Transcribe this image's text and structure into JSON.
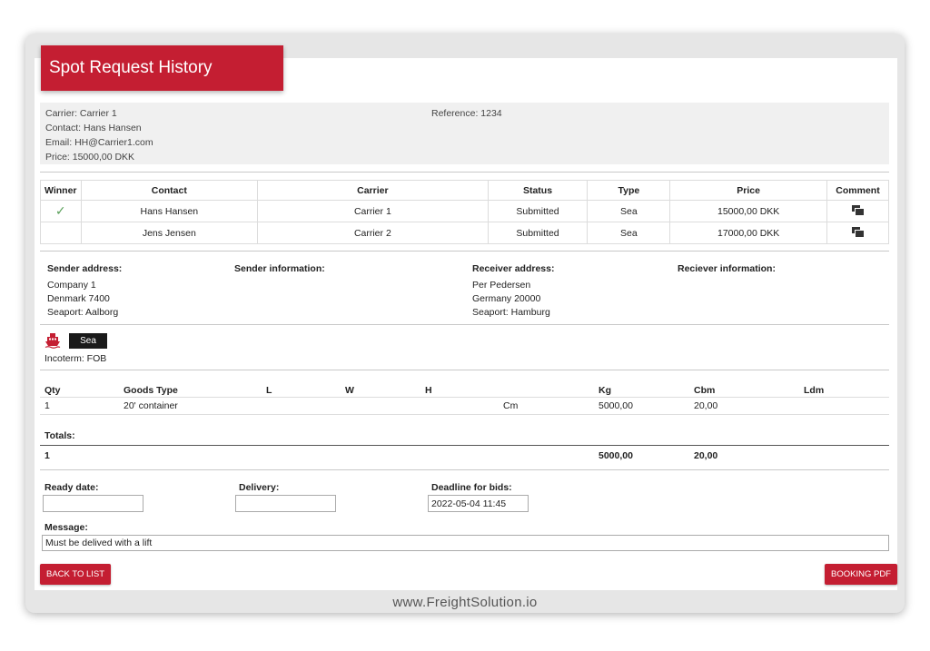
{
  "page": {
    "title": "Spot Request History",
    "footer_url": "www.FreightSolution.io"
  },
  "summary": {
    "carrier": "Carrier: Carrier 1",
    "contact": "Contact: Hans Hansen",
    "email": "Email: HH@Carrier1.com",
    "price": "Price: 15000,00 DKK",
    "reference": "Reference: 1234"
  },
  "bids_table": {
    "headers": [
      "Winner",
      "Contact",
      "Carrier",
      "Status",
      "Type",
      "Price",
      "Comment"
    ],
    "rows": [
      {
        "winner": "✓",
        "contact": "Hans Hansen",
        "carrier": "Carrier 1",
        "status": "Submitted",
        "type": "Sea",
        "price": "15000,00 DKK"
      },
      {
        "winner": "",
        "contact": "Jens Jensen",
        "carrier": "Carrier 2",
        "status": "Submitted",
        "type": "Sea",
        "price": "17000,00 DKK"
      }
    ]
  },
  "addresses": {
    "sender_address_label": "Sender address:",
    "sender_address_lines": [
      "Company 1",
      "Denmark 7400",
      "Seaport: Aalborg"
    ],
    "sender_info_label": "Sender information:",
    "receiver_address_label": "Receiver address:",
    "receiver_address_lines": [
      "Per Pedersen",
      "Germany 20000",
      "Seaport: Hamburg"
    ],
    "receiver_info_label": "Reciever information:"
  },
  "transport": {
    "mode": "Sea",
    "incoterm": "Incoterm: FOB",
    "mode_icon": "ship-icon"
  },
  "goods": {
    "headers": {
      "qty": "Qty",
      "goods_type": "Goods Type",
      "l": "L",
      "w": "W",
      "h": "H",
      "kg": "Kg",
      "cbm": "Cbm",
      "ldm": "Ldm"
    },
    "rows": [
      {
        "qty": "1",
        "goods_type": "20' container",
        "unit": "Cm",
        "kg": "5000,00",
        "cbm": "20,00"
      }
    ],
    "totals_label": "Totals:",
    "totals": {
      "qty": "1",
      "kg": "5000,00",
      "cbm": "20,00"
    }
  },
  "form": {
    "ready_date_label": "Ready date:",
    "ready_date_value": "",
    "delivery_label": "Delivery:",
    "delivery_value": "",
    "deadline_label": "Deadline for bids:",
    "deadline_value": "2022-05-04 11:45",
    "message_label": "Message:",
    "message_value": "Must be delived with a lift"
  },
  "buttons": {
    "back": "BACK TO LIST",
    "booking_pdf": "BOOKING PDF"
  },
  "colors": {
    "brand": "#c41e32",
    "winner_check": "#5aa05a"
  }
}
